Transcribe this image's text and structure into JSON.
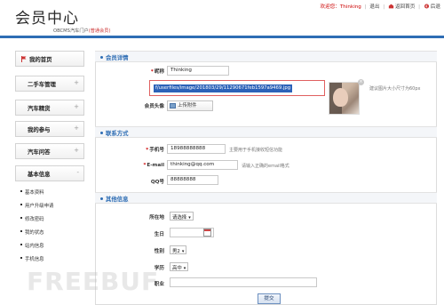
{
  "header": {
    "title": "会员中心",
    "subtitle": "OBCMS汽车门户",
    "member_level": "(普通会员)",
    "welcome": "欢迎您：Thinking",
    "logout": "退出",
    "home": "返回首页",
    "back": "后退"
  },
  "sidebar": {
    "items": [
      {
        "label": "我的首页"
      },
      {
        "label": "二手车管理",
        "toggle": "+"
      },
      {
        "label": "汽车精货",
        "toggle": "+"
      },
      {
        "label": "我的参与",
        "toggle": "+"
      },
      {
        "label": "汽车问答",
        "toggle": "+"
      },
      {
        "label": "基本信息",
        "toggle": "-"
      }
    ],
    "subitems": [
      "基本资料",
      "用户升级申请",
      "修改密码",
      "我的状态",
      "站内信息",
      "手机信息"
    ]
  },
  "sections": {
    "member_info": "会员详情",
    "contact": "联系方式",
    "other": "其他信息"
  },
  "form": {
    "nickname_label": "昵称",
    "nickname_value": "Thinking",
    "avatar_path": "f/userfiles/image/201803/29/11290671feb1597a9469.jpg",
    "avatar_label": "会员头像",
    "upload_label": "上传附件",
    "avatar_hint": "建议图片大小尺寸为60px",
    "phone_label": "手机号",
    "phone_value": "18988888888",
    "phone_hint": "主要用于手机接收短信功能",
    "email_label": "E-mail",
    "email_value": "thinking@qq.com",
    "email_hint": "请输入正确的email格式",
    "qq_label": "QQ号",
    "qq_value": "88888888",
    "location_label": "所在地",
    "location_value": "请选择",
    "birthday_label": "生日",
    "gender_label": "性别",
    "gender_value": "男2",
    "education_label": "学历",
    "education_value": "高中",
    "job_label": "职业",
    "submit_label": "提交"
  },
  "watermark": "FREEBUF",
  "colors": {
    "accent": "#2e6db4",
    "header_line": "#2e6db4",
    "required": "#c00000",
    "selection": "#2c62b8"
  }
}
